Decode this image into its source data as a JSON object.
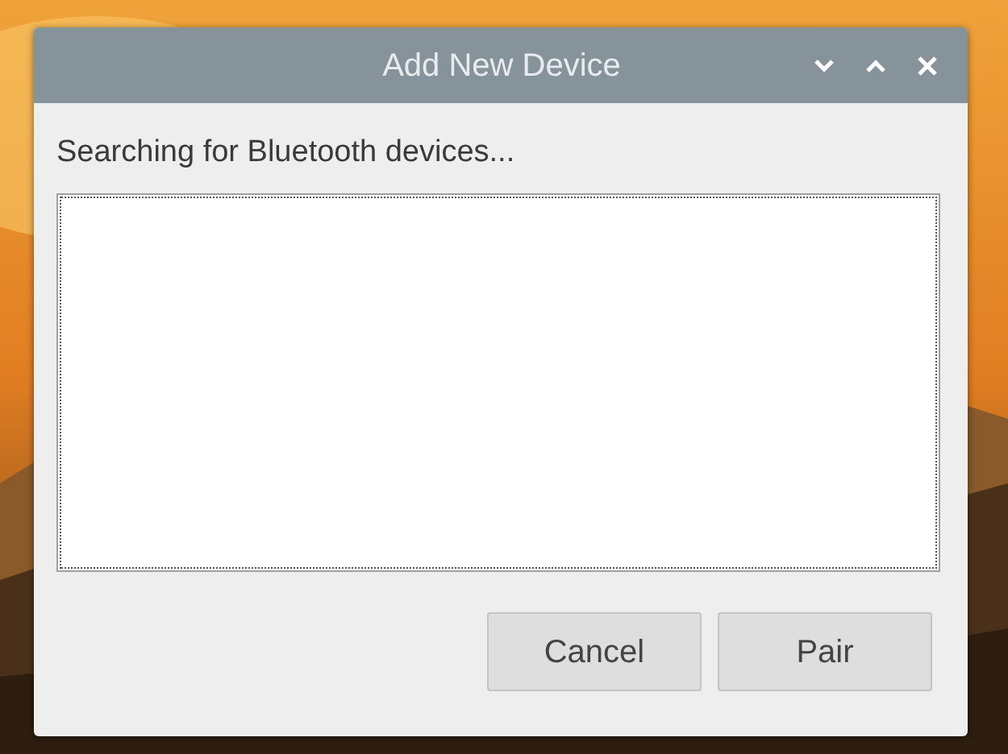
{
  "window": {
    "title": "Add New Device"
  },
  "message": "Searching for Bluetooth devices...",
  "buttons": [
    {
      "label": "Cancel"
    },
    {
      "label": "Pair"
    }
  ]
}
